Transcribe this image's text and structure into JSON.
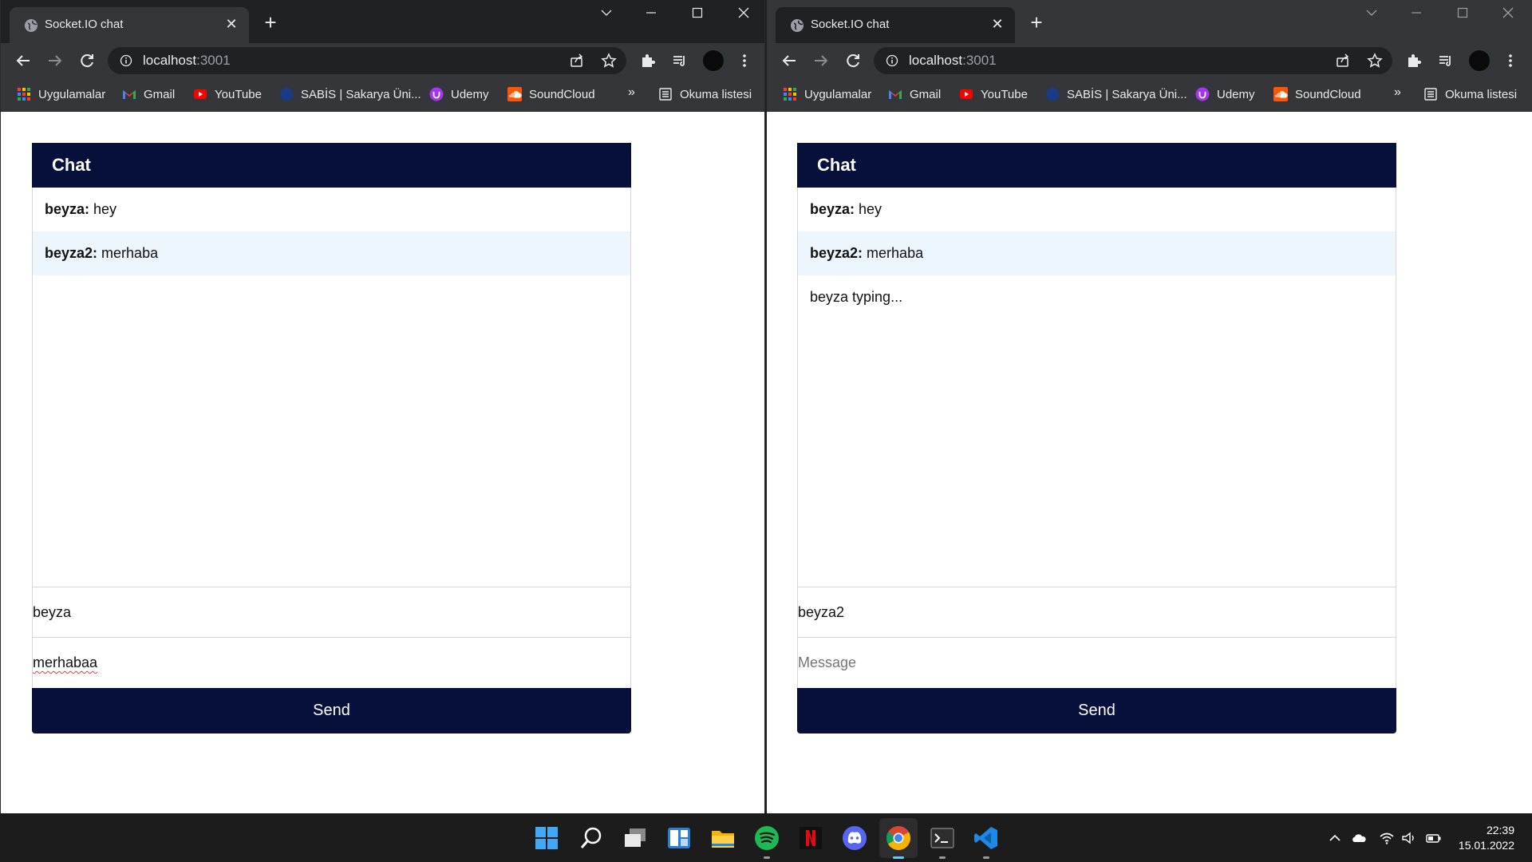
{
  "browser_left": {
    "tab_title": "Socket.IO chat",
    "url_host": "localhost",
    "url_port": ":3001",
    "bookmarks": [
      "Uygulamalar",
      "Gmail",
      "YouTube",
      "SABİS | Sakarya Üni...",
      "Udemy",
      "SoundCloud"
    ],
    "bookmarks_overflow": "»",
    "reading_list": "Okuma listesi",
    "chat": {
      "title": "Chat",
      "messages": [
        {
          "user": "beyza:",
          "text": " hey"
        },
        {
          "user": "beyza2:",
          "text": " merhaba"
        }
      ],
      "name_value": "beyza",
      "message_value": "merhabaa",
      "send_label": "Send"
    }
  },
  "browser_right": {
    "tab_title": "Socket.IO chat",
    "url_host": "localhost",
    "url_port": ":3001",
    "bookmarks": [
      "Uygulamalar",
      "Gmail",
      "YouTube",
      "SABİS | Sakarya Üni...",
      "Udemy",
      "SoundCloud"
    ],
    "bookmarks_overflow": "»",
    "reading_list": "Okuma listesi",
    "chat": {
      "title": "Chat",
      "messages": [
        {
          "user": "beyza:",
          "text": " hey"
        },
        {
          "user": "beyza2:",
          "text": " merhaba"
        }
      ],
      "typing_status": "beyza typing...",
      "name_value": "beyza2",
      "message_placeholder": "Message",
      "send_label": "Send"
    }
  },
  "taskbar": {
    "apps": [
      "start-icon",
      "search-icon",
      "task-view-icon",
      "widgets-icon",
      "file-explorer-icon",
      "spotify-icon",
      "netflix-icon",
      "discord-icon",
      "chrome-icon",
      "terminal-icon",
      "vscode-icon"
    ],
    "active_app": "chrome-icon",
    "time": "22:39",
    "date": "15.01.2022"
  },
  "colors": {
    "chat_header": "#06103a",
    "alt_row": "#eef6fd",
    "chrome_dark": "#202124",
    "chrome_toolbar": "#35363a"
  }
}
